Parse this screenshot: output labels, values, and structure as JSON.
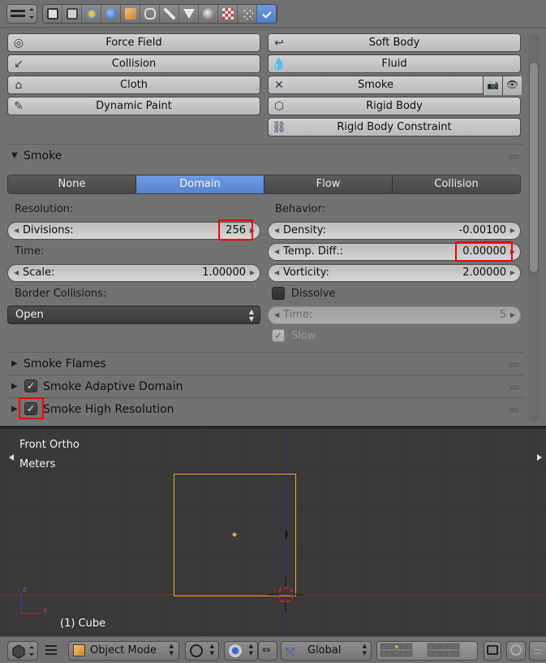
{
  "header": {
    "editor_type_icon": "properties-editor-icon",
    "context_tabs": [
      "render-icon",
      "render-layers-icon",
      "scene-icon",
      "world-icon",
      "object-icon",
      "constraints-icon",
      "modifiers-icon",
      "data-icon",
      "material-icon",
      "texture-icon",
      "particles-icon",
      "physics-icon"
    ],
    "active_tab": "physics-icon"
  },
  "physics_buttons": {
    "force_field": "Force Field",
    "collision": "Collision",
    "cloth": "Cloth",
    "dynamic_paint": "Dynamic Paint",
    "soft_body": "Soft Body",
    "fluid": "Fluid",
    "smoke": "Smoke",
    "rigid_body": "Rigid Body",
    "rigid_body_constraint": "Rigid Body Constraint"
  },
  "smoke_panel": {
    "title": "Smoke",
    "types": [
      "None",
      "Domain",
      "Flow",
      "Collision"
    ],
    "active_type": "Domain",
    "resolution_label": "Resolution:",
    "divisions_label": "Divisions:",
    "divisions_value": "256",
    "time_label": "Time:",
    "scale_label": "Scale:",
    "scale_value": "1.00000",
    "border_collisions_label": "Border Collisions:",
    "border_collisions_value": "Open",
    "behavior_label": "Behavior:",
    "density_label": "Density:",
    "density_value": "-0.00100",
    "temp_diff_label": "Temp. Diff.:",
    "temp_diff_value": "0.00000",
    "vorticity_label": "Vorticity:",
    "vorticity_value": "2.00000",
    "dissolve_label": "Dissolve",
    "dissolve_checked": false,
    "dissolve_time_label": "Time:",
    "dissolve_time_value": "5",
    "slow_label": "Slow",
    "slow_checked": true
  },
  "subpanels": {
    "smoke_flames": "Smoke Flames",
    "smoke_adaptive_domain": "Smoke Adaptive Domain",
    "smoke_adaptive_checked": true,
    "smoke_high_resolution": "Smoke High Resolution",
    "smoke_high_res_checked": true
  },
  "viewport": {
    "view_name": "Front Ortho",
    "units": "Meters",
    "object_info": "(1) Cube",
    "axis_z": "z",
    "axis_x": "x"
  },
  "bottom_header": {
    "mode": "Object Mode",
    "orientation": "Global"
  },
  "colors": {
    "panel_bg": "#727272",
    "active_blue": "#5683d0",
    "highlight_red": "#ff0000",
    "selection_orange": "#f0a030",
    "x_axis": "#a03030",
    "z_axis": "#2a2a9a"
  }
}
